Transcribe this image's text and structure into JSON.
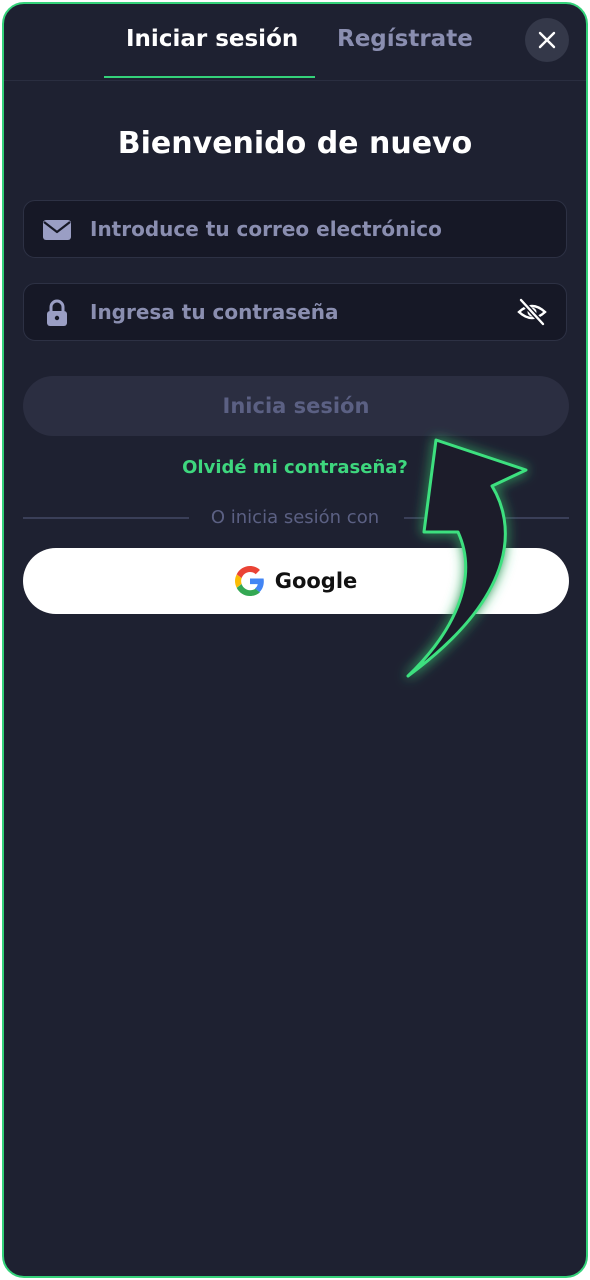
{
  "tabs": {
    "login_label": "Iniciar sesión",
    "register_label": "Regístrate",
    "active": "login"
  },
  "title": "Bienvenido de nuevo",
  "email": {
    "placeholder": "Introduce tu correo electrónico",
    "icon": "envelope-icon"
  },
  "password": {
    "placeholder": "Ingresa tu contraseña",
    "icon": "lock-icon",
    "toggle_icon": "eye-slash-icon"
  },
  "login_button": "Inicia sesión",
  "forgot_link": "Olvidé mi contraseña?",
  "divider_text": "O inicia sesión con",
  "google_button": "Google",
  "close_icon": "close-icon",
  "colors": {
    "background": "#1e2131",
    "accent": "#34d27a",
    "field_bg": "#161826",
    "muted_text": "#8a8eb0"
  }
}
